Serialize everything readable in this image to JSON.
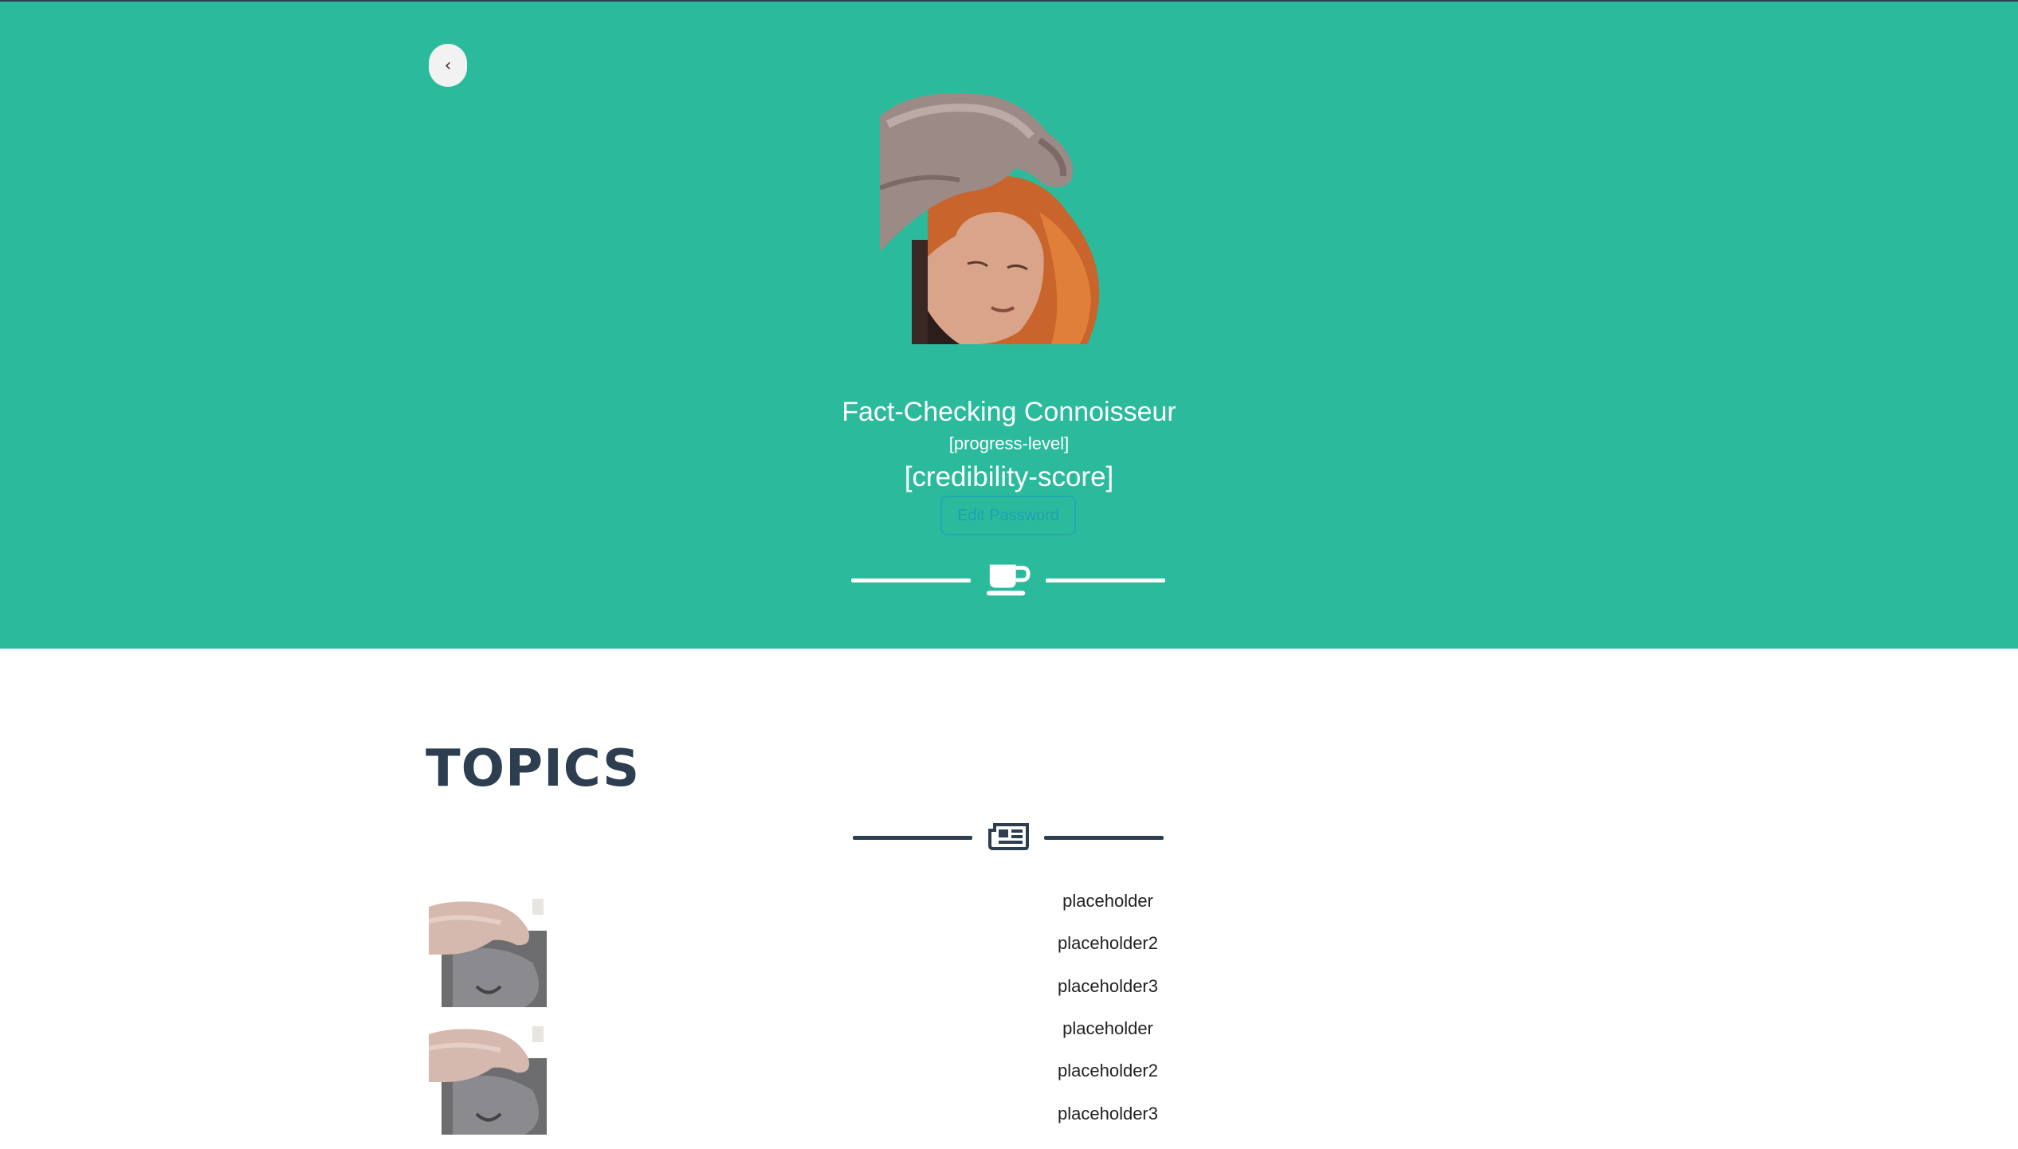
{
  "header": {
    "back_label": "‹"
  },
  "profile": {
    "title": "Fact-Checking Connoisseur",
    "progress_level": "[progress-level]",
    "credibility_score": "[credibility-score]",
    "edit_password_label": "Edit Password",
    "divider_icon": "coffee-cup-icon"
  },
  "topics": {
    "heading": "TOPICS",
    "divider_icon": "newspaper-icon",
    "groups": [
      {
        "items": [
          "placeholder",
          "placeholder2",
          "placeholder3"
        ]
      },
      {
        "items": [
          "placeholder",
          "placeholder2",
          "placeholder3"
        ]
      }
    ]
  },
  "colors": {
    "hero_bg": "#2bbb9c",
    "dark_text": "#2c3e50",
    "edit_button": "#24a6b4"
  }
}
